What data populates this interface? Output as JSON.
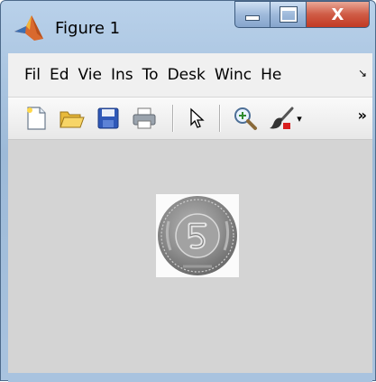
{
  "window": {
    "title": "Figure 1",
    "controls": {
      "minimize": "minimize",
      "maximize": "maximize",
      "close": "X"
    }
  },
  "menubar": {
    "items": [
      "Fil",
      "Ed",
      "Vie",
      "Ins",
      "To",
      "Desk",
      "Winc",
      "He"
    ],
    "overflow_glyph": "↘"
  },
  "toolbar": {
    "buttons": [
      "new-figure-icon",
      "open-icon",
      "save-icon",
      "print-icon",
      "pointer-arrow-icon",
      "zoom-in-icon",
      "brush-icon"
    ],
    "brush_dropdown_glyph": "▾",
    "overflow_glyph": "»"
  },
  "figure": {
    "background_color": "#d4d4d4",
    "image_content": "coin-image"
  }
}
